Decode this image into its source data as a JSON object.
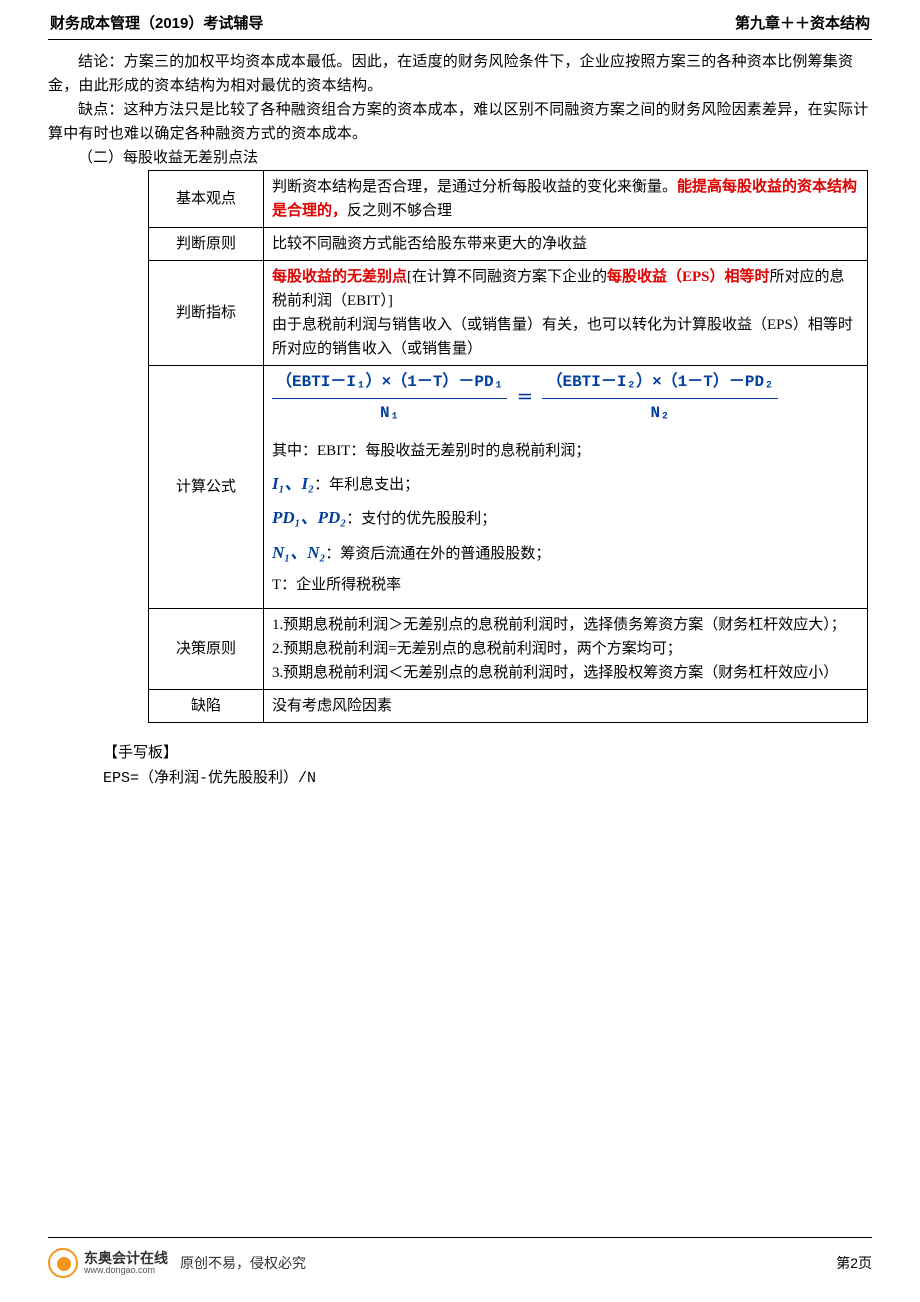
{
  "header": {
    "left": "财务成本管理（2019）考试辅导",
    "right": "第九章＋＋资本结构"
  },
  "paragraphs": {
    "conclusion": "结论：方案三的加权平均资本成本最低。因此，在适度的财务风险条件下，企业应按照方案三的各种资本比例筹集资金，由此形成的资本结构为相对最优的资本结构。",
    "drawback": "缺点：这种方法只是比较了各种融资组合方案的资本成本，难以区别不同融资方案之间的财务风险因素差异，在实际计算中有时也难以确定各种融资方式的资本成本。",
    "section_heading": "（二）每股收益无差别点法"
  },
  "table": {
    "rows": [
      {
        "label": "基本观点",
        "content_pre": "判断资本结构是否合理，是通过分析每股收益的变化来衡量。",
        "content_red": "能提高每股收益的资本结构是合理的，",
        "content_post": "反之则不够合理"
      },
      {
        "label": "判断原则",
        "content": "比较不同融资方式能否给股东带来更大的净收益"
      },
      {
        "label": "判断指标",
        "red1": "每股收益的无差别点",
        "mid1": "[在计算不同融资方案下企业的",
        "red2": "每股收益（EPS）相等时",
        "mid2": "所对应的息税前利润（EBIT）]",
        "line2": "由于息税前利润与销售收入（或销售量）有关，也可以转化为计算股收益（EPS）相等时所对应的销售收入（或销售量）"
      },
      {
        "label": "计算公式",
        "formula": {
          "num1": "（EBTI－I₁）×（1－T）－PD₁",
          "den1": "N₁",
          "eq": "＝",
          "num2": "（EBTI－I₂）×（1－T）－PD₂",
          "den2": "N₂"
        },
        "explain_ebit": "其中：EBIT：每股收益无差别时的息税前利润；",
        "var_i": "I₁、I₂",
        "explain_i": "：年利息支出；",
        "var_pd": "PD₁、PD₂",
        "explain_pd": "：支付的优先股股利；",
        "var_n": "N₁、N₂",
        "explain_n": "：筹资后流通在外的普通股股数；",
        "explain_t": "T：企业所得税税率"
      },
      {
        "label": "决策原则",
        "line1": "1.预期息税前利润＞无差别点的息税前利润时，选择债务筹资方案（财务杠杆效应大）；",
        "line2": "2.预期息税前利润=无差别点的息税前利润时，两个方案均可；",
        "line3": "3.预期息税前利润＜无差别点的息税前利润时，选择股权筹资方案（财务杠杆效应小）"
      },
      {
        "label": "缺陷",
        "content": "没有考虑风险因素"
      }
    ]
  },
  "handwriting": {
    "title": "【手写板】",
    "content": "EPS=（净利润-优先股股利）/N"
  },
  "footer": {
    "logo_cn": "东奥会计在线",
    "logo_url": "www.dongao.com",
    "copyright": "原创不易，侵权必究",
    "page": "第2页"
  }
}
